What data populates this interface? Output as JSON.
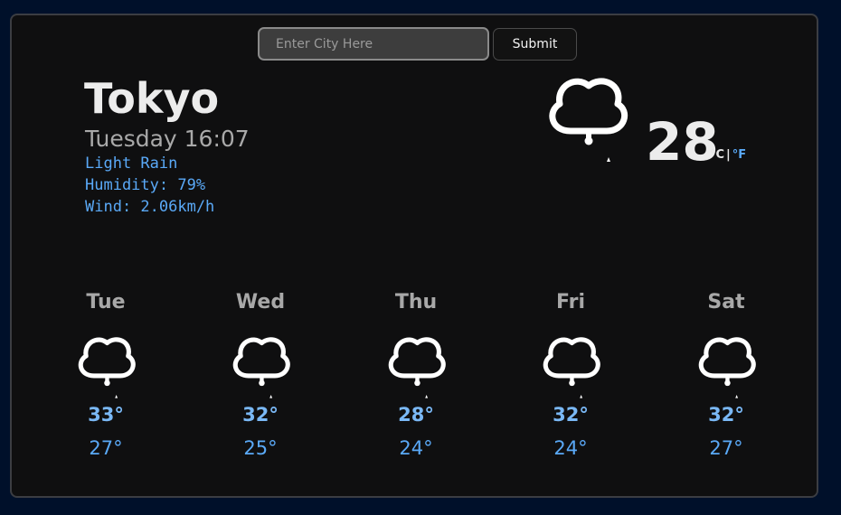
{
  "search": {
    "placeholder": "Enter City Here",
    "value": "",
    "submit_label": "Submit"
  },
  "current": {
    "city": "Tokyo",
    "datetime": "Tuesday 16:07",
    "condition": "Light Rain",
    "humidity": "Humidity: 79%",
    "wind": "Wind: 2.06km/h",
    "icon": "light-rain-icon",
    "temperature": "28",
    "unit_c": "°C",
    "unit_sep": "|",
    "unit_f": "°F"
  },
  "forecast": [
    {
      "day": "Tue",
      "icon": "light-rain-icon",
      "high": "33°",
      "low": "27°"
    },
    {
      "day": "Wed",
      "icon": "light-rain-icon",
      "high": "32°",
      "low": "25°"
    },
    {
      "day": "Thu",
      "icon": "light-rain-icon",
      "high": "28°",
      "low": "24°"
    },
    {
      "day": "Fri",
      "icon": "light-rain-icon",
      "high": "32°",
      "low": "24°"
    },
    {
      "day": "Sat",
      "icon": "light-rain-icon",
      "high": "32°",
      "low": "27°"
    }
  ],
  "colors": {
    "background": "#00102a",
    "card": "#0f0f10",
    "accent": "#5aa9f7",
    "text_primary": "#ececec",
    "text_secondary": "#a9a9a9"
  }
}
